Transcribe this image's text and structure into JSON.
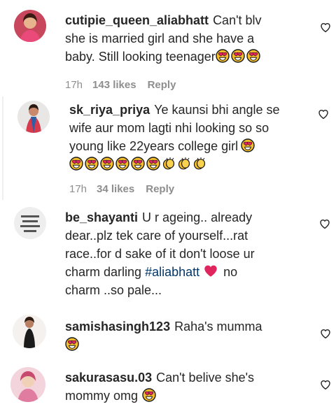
{
  "comments": [
    {
      "username": "cutipie_queen_aliabhatt",
      "lines": [
        "Can't blv",
        "she is married girl and she have a",
        "baby. Still looking teenager"
      ],
      "emoji_count": 3,
      "time": "17h",
      "likes": "143 likes",
      "reply": "Reply"
    },
    {
      "username": "sk_riya_priya",
      "lines": [
        "Ye kaunsi bhi angle se",
        "wife aur mom lagti nhi looking so so",
        "young like 22years college girl"
      ],
      "emoji_count": 7,
      "clap_count": 3,
      "time": "17h",
      "likes": "34 likes",
      "reply": "Reply"
    },
    {
      "username": "be_shayanti",
      "lines": [
        "U r ageing.. already",
        "dear..plz tek care of yourself...rat",
        "race..for d sake of it don't loose ur",
        "charm darling",
        "#aliabhatt",
        "no",
        "charm ..so pale..."
      ]
    },
    {
      "username": "samishasingh123",
      "lines": [
        "Raha's mumma"
      ]
    },
    {
      "username": "sakurasasu.03",
      "lines": [
        "Can't belive she's",
        "mommy omg"
      ]
    }
  ],
  "icons": {
    "like": "heart-outline-icon",
    "heart_eyes": "heart-eyes-emoji",
    "clap": "clapping-hands-emoji",
    "red_heart": "red-heart-emoji"
  },
  "colors": {
    "text": "#262626",
    "meta": "#8e8e8e",
    "hashtag": "#00376b",
    "emoji_face": "#f7c02b",
    "emoji_heart": "#e0245e"
  }
}
